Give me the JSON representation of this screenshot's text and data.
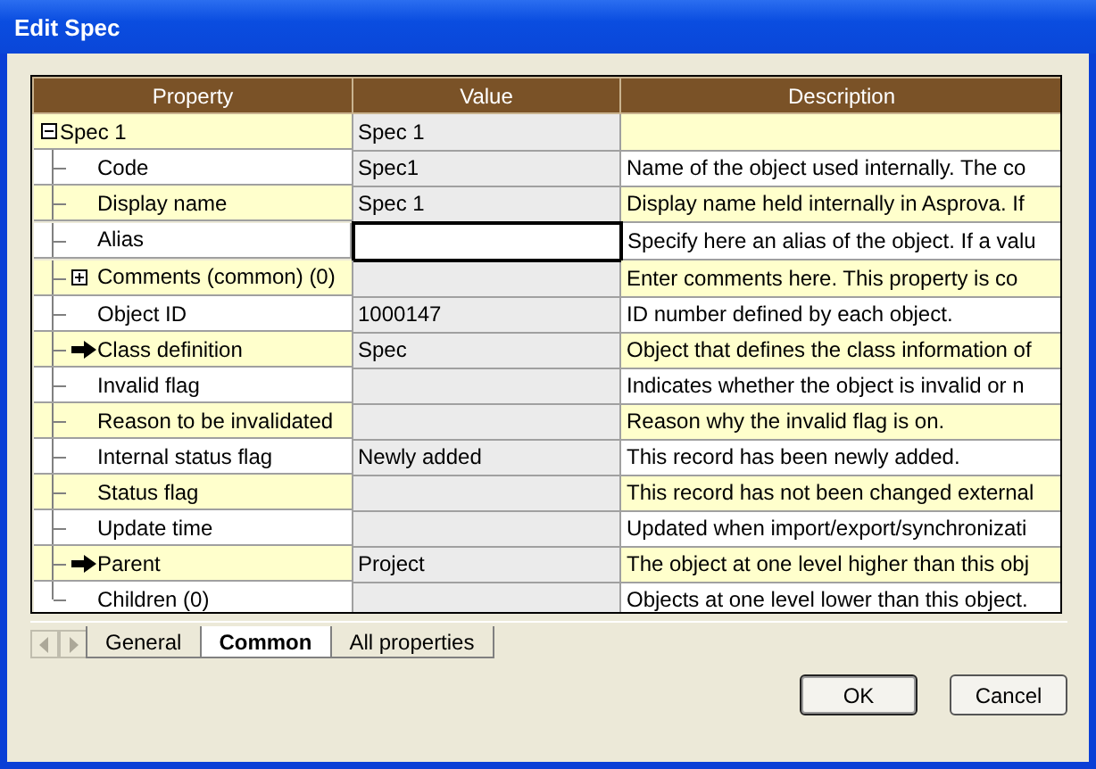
{
  "window": {
    "title": "Edit Spec"
  },
  "table": {
    "columns": [
      "Property",
      "Value",
      "Description"
    ],
    "root": {
      "property": "Spec 1",
      "value": "Spec 1",
      "expanded": true,
      "children": [
        {
          "kind": "plain",
          "property": "Code",
          "value": "Spec1",
          "description": "Name of the object used internally. The co",
          "focused": false
        },
        {
          "kind": "plain",
          "property": "Display name",
          "value": "Spec 1",
          "description": "Display name held internally in Asprova. If",
          "focused": false
        },
        {
          "kind": "plain",
          "property": "Alias",
          "description": "Specify here an alias of the object. If a valu",
          "focused": true
        },
        {
          "kind": "group",
          "property": "Comments (common) (0)",
          "description": "Enter comments here. This property is co",
          "focused": false,
          "expanded": false
        },
        {
          "kind": "plain",
          "property": "Object ID",
          "value": "1000147",
          "description": "ID number defined by each object.",
          "focused": false
        },
        {
          "kind": "link",
          "property": "Class definition",
          "value": "Spec",
          "description": "Object that defines the class information of",
          "focused": false
        },
        {
          "kind": "plain",
          "property": "Invalid flag",
          "description": "Indicates whether the object is invalid or n",
          "focused": false
        },
        {
          "kind": "plain",
          "property": "Reason to be invalidated",
          "description": "Reason why the invalid flag is on.",
          "focused": false
        },
        {
          "kind": "plain",
          "property": "Internal status flag",
          "value": "Newly added",
          "description": "This record has been newly added.",
          "focused": false
        },
        {
          "kind": "plain",
          "property": "Status flag",
          "description": "This record has not been changed external",
          "focused": false
        },
        {
          "kind": "plain",
          "property": "Update time",
          "description": "Updated when import/export/synchronizati",
          "focused": false
        },
        {
          "kind": "link",
          "property": "Parent",
          "value": "Project",
          "description": "The object at one level higher than this obj",
          "focused": false
        },
        {
          "kind": "plain",
          "property": "Children (0)",
          "description": "Objects at one level lower than this object.",
          "focused": false
        }
      ]
    }
  },
  "tabs": [
    {
      "label": "General",
      "selected": false
    },
    {
      "label": "Common",
      "selected": true
    },
    {
      "label": "All properties",
      "selected": false
    }
  ],
  "buttons": [
    "OK",
    "Cancel"
  ]
}
